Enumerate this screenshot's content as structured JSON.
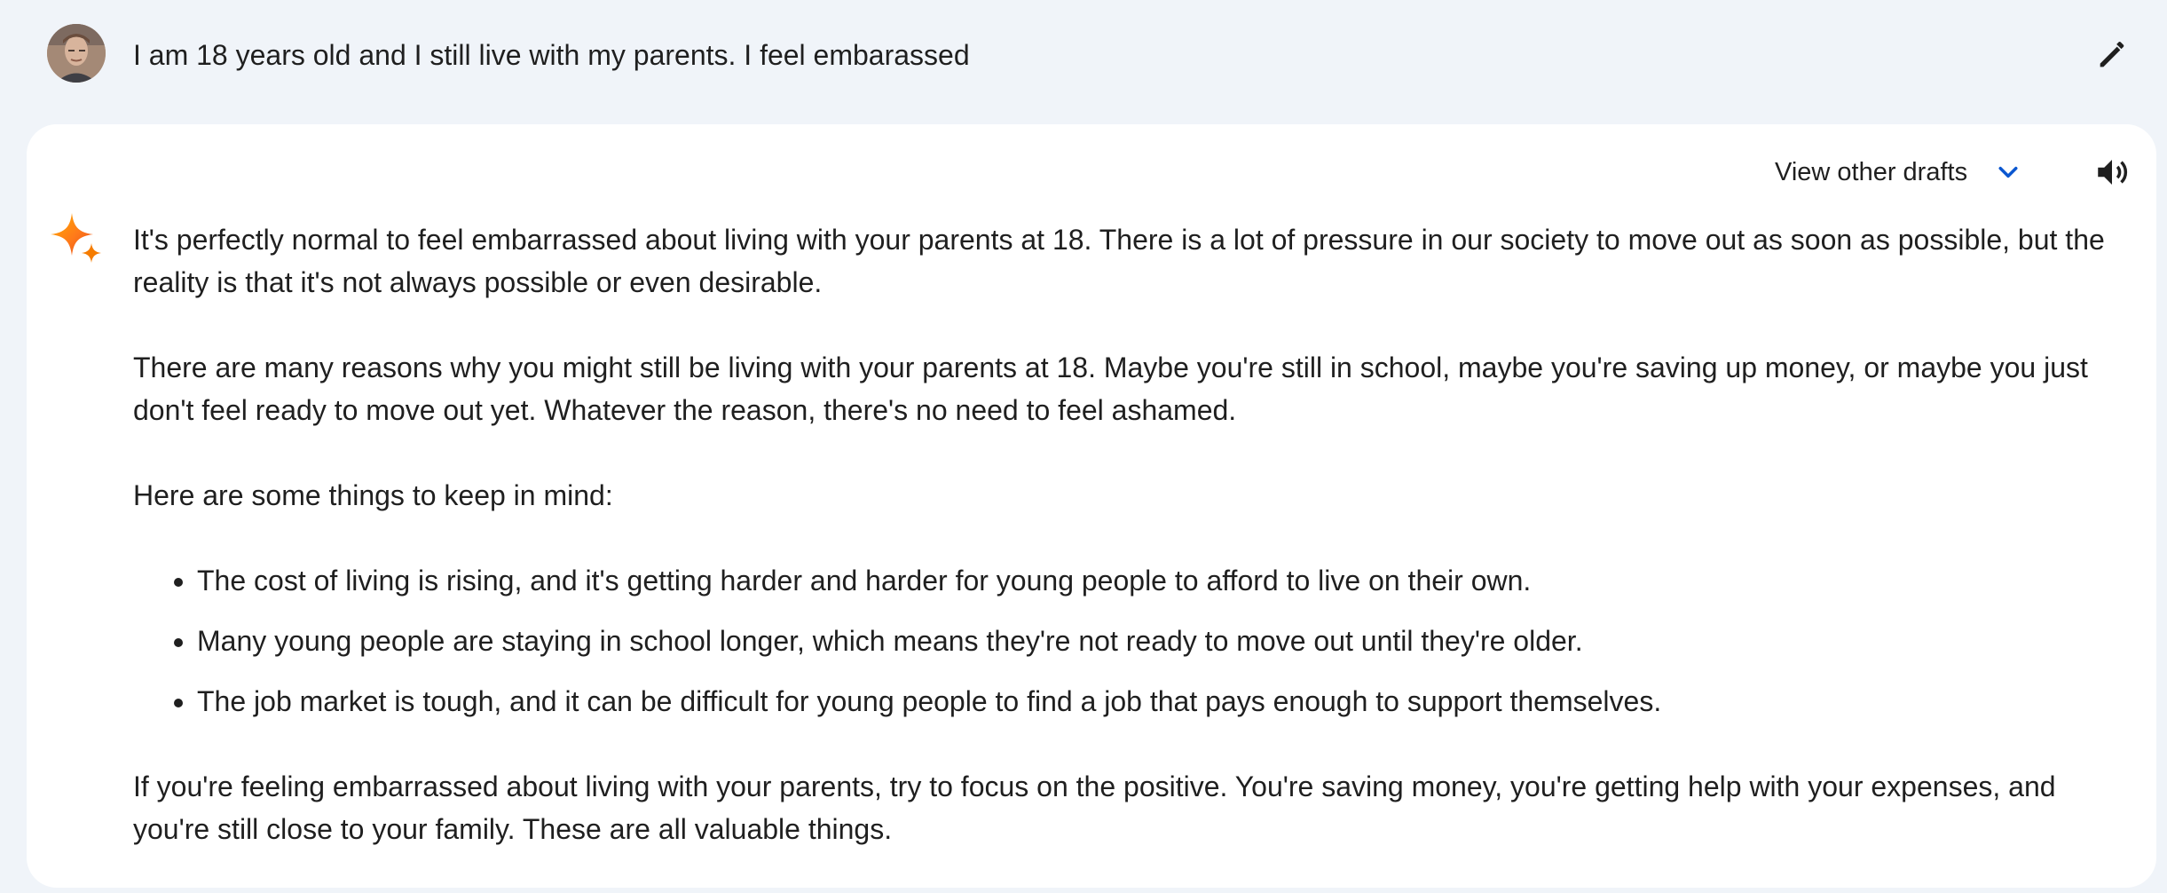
{
  "prompt": {
    "text": "I am 18 years old and I still live with my parents. I feel embarassed",
    "avatar_icon": "user-avatar-photo",
    "edit_icon": "pencil-icon"
  },
  "response": {
    "drafts_label": "View other drafts",
    "drafts_icon": "chevron-down-icon",
    "speaker_icon": "volume-icon",
    "assistant_icon": "sparkle-icon",
    "paragraphs": [
      "It's perfectly normal to feel embarrassed about living with your parents at 18. There is a lot of pressure in our society to move out as soon as possible, but the reality is that it's not always possible or even desirable.",
      "There are many reasons why you might still be living with your parents at 18. Maybe you're still in school, maybe you're saving up money, or maybe you just don't feel ready to move out yet. Whatever the reason, there's no need to feel ashamed.",
      "Here are some things to keep in mind:"
    ],
    "bullets": [
      "The cost of living is rising, and it's getting harder and harder for young people to afford to live on their own.",
      "Many young people are staying in school longer, which means they're not ready to move out until they're older.",
      "The job market is tough, and it can be difficult for young people to find a job that pays enough to support themselves."
    ],
    "closing": "If you're feeling embarrassed about living with your parents, try to focus on the positive. You're saving money, you're getting help with your expenses, and you're still close to your family. These are all valuable things."
  },
  "colors": {
    "page_background": "#f0f4f9",
    "card_background": "#ffffff",
    "text": "#1f1f1f",
    "accent_blue": "#0b57d0"
  }
}
